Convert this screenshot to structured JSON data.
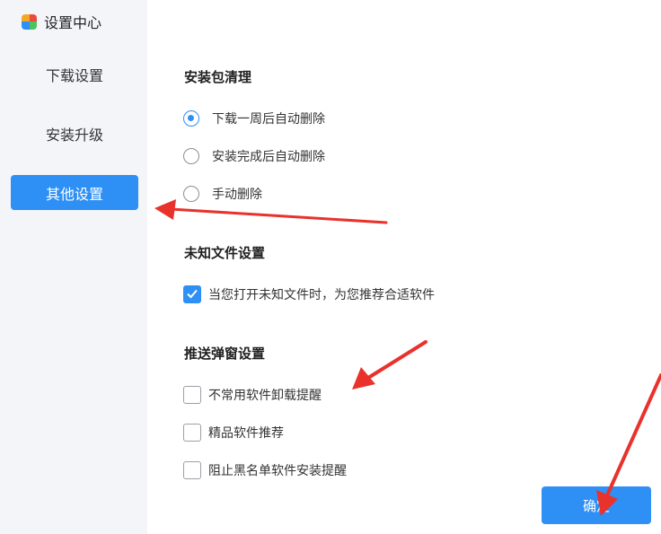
{
  "sidebar": {
    "app_title": "设置中心",
    "logo_colors": [
      "#f5a623",
      "#e94b3c",
      "#2e8ff5",
      "#4cc261"
    ],
    "items": [
      {
        "label": "下载设置",
        "active": false
      },
      {
        "label": "安装升级",
        "active": false
      },
      {
        "label": "其他设置",
        "active": true
      }
    ]
  },
  "main": {
    "package_cleanup": {
      "title": "安装包清理",
      "options": [
        {
          "label": "下载一周后自动删除",
          "selected": true
        },
        {
          "label": "安装完成后自动删除",
          "selected": false
        },
        {
          "label": "手动删除",
          "selected": false
        }
      ]
    },
    "unknown_files": {
      "title": "未知文件设置",
      "options": [
        {
          "label": "当您打开未知文件时，为您推荐合适软件",
          "checked": true
        }
      ]
    },
    "push_popup": {
      "title": "推送弹窗设置",
      "options": [
        {
          "label": "不常用软件卸载提醒",
          "checked": false
        },
        {
          "label": "精品软件推荐",
          "checked": false
        },
        {
          "label": "阻止黑名单软件安装提醒",
          "checked": false
        }
      ]
    },
    "confirm_label": "确定"
  },
  "colors": {
    "accent": "#2e8ff5",
    "sidebar_bg": "#f3f5f8",
    "annotation_arrow": "#e8322b"
  }
}
